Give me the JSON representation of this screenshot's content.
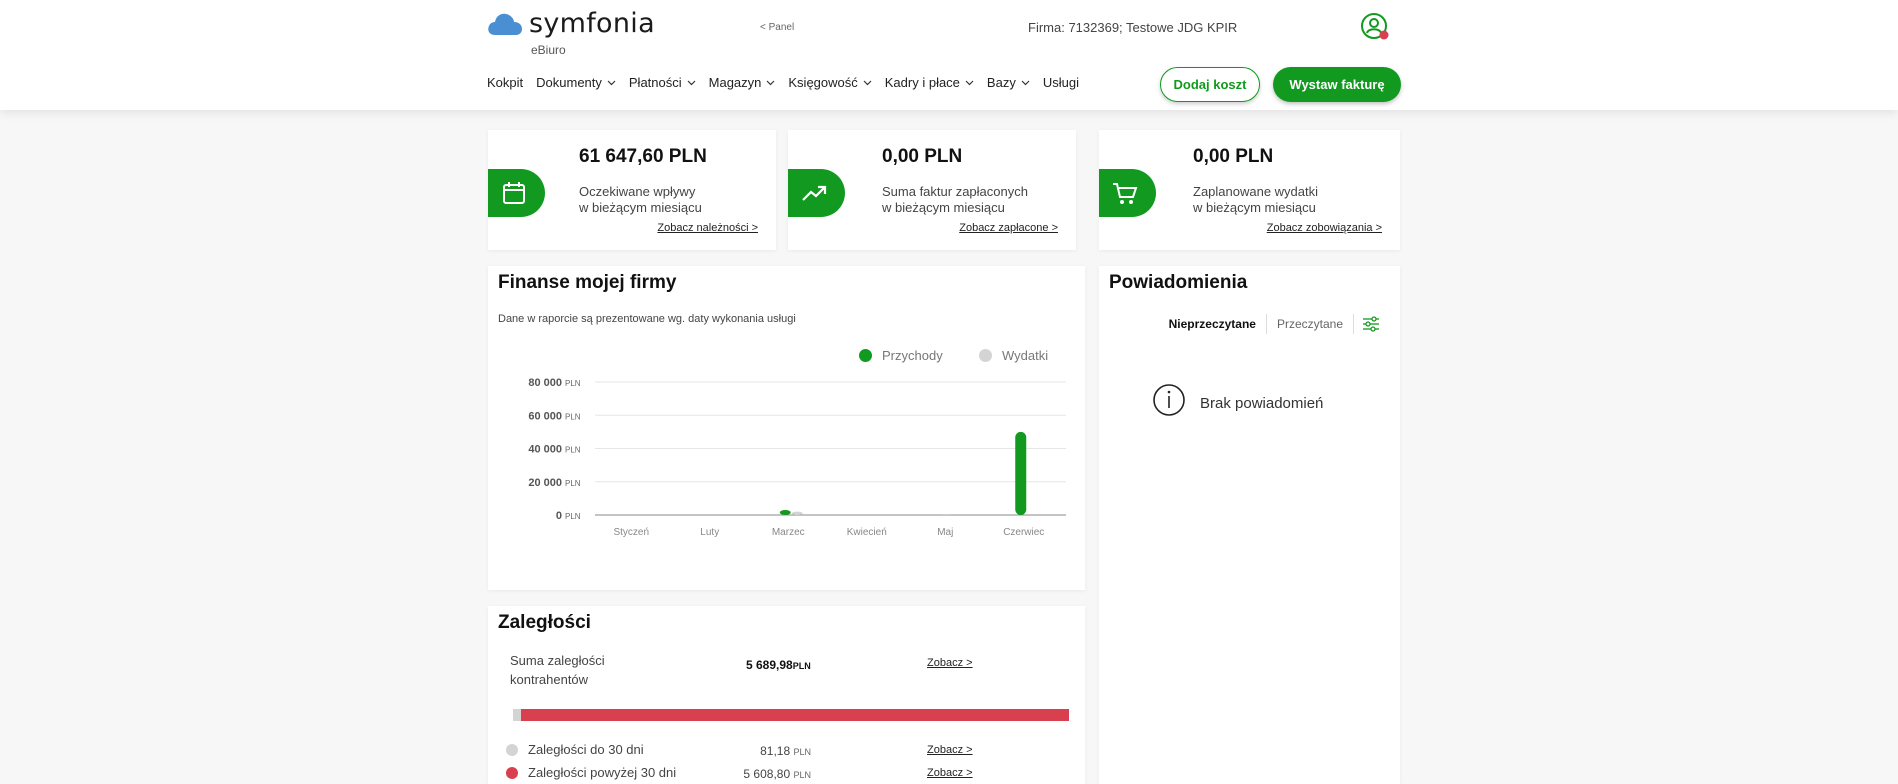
{
  "header": {
    "logo_text": "symfonia",
    "logo_sub": "eBiuro",
    "back_link": "< Panel",
    "company": "Firma:  7132369; Testowe JDG KPIR",
    "nav": [
      {
        "label": "Kokpit",
        "dropdown": false
      },
      {
        "label": "Dokumenty",
        "dropdown": true
      },
      {
        "label": "Płatności",
        "dropdown": true
      },
      {
        "label": "Magazyn",
        "dropdown": true
      },
      {
        "label": "Księgowość",
        "dropdown": true
      },
      {
        "label": "Kadry i płace",
        "dropdown": true
      },
      {
        "label": "Bazy",
        "dropdown": true
      },
      {
        "label": "Usługi",
        "dropdown": false
      }
    ],
    "btn_add_cost": "Dodaj koszt",
    "btn_invoice": "Wystaw fakturę"
  },
  "stats": [
    {
      "amount": "61 647,60 PLN",
      "line1": "Oczekiwane wpływy",
      "line2": "w bieżącym miesiącu",
      "link": "Zobacz należności >",
      "icon": "calendar-icon"
    },
    {
      "amount": "0,00 PLN",
      "line1": "Suma faktur zapłaconych",
      "line2": "w bieżącym miesiącu",
      "link": "Zobacz zapłacone >",
      "icon": "trend-up-icon"
    },
    {
      "amount": "0,00 PLN",
      "line1": "Zaplanowane wydatki",
      "line2": "w bieżącym miesiącu",
      "link": "Zobacz zobowiązania >",
      "icon": "cart-icon"
    }
  ],
  "finance": {
    "title": "Finanse mojej firmy",
    "subtitle": "Dane w raporcie są prezentowane wg. daty wykonania usługi"
  },
  "chart_data": {
    "type": "bar",
    "categories": [
      "Styczeń",
      "Luty",
      "Marzec",
      "Kwiecień",
      "Maj",
      "Czerwiec"
    ],
    "series": [
      {
        "name": "Przychody",
        "color": "#119a1f",
        "values": [
          0,
          0,
          3000,
          0,
          0,
          50000
        ]
      },
      {
        "name": "Wydatki",
        "color": "#d4d4d4",
        "values": [
          0,
          0,
          2000,
          0,
          0,
          0
        ]
      }
    ],
    "yticks": [
      {
        "value": 0,
        "label": "0"
      },
      {
        "value": 20000,
        "label": "20 000"
      },
      {
        "value": 40000,
        "label": "40 000"
      },
      {
        "value": 60000,
        "label": "60 000"
      },
      {
        "value": 80000,
        "label": "80 000"
      }
    ],
    "yunit": "PLN",
    "ylim": [
      0,
      80000
    ],
    "legend_position": "top-right",
    "grid": true
  },
  "notifications": {
    "title": "Powiadomienia",
    "tab_unread": "Nieprzeczytane",
    "tab_read": "Przeczytane",
    "empty": "Brak powiadomień"
  },
  "arrears": {
    "title": "Zaległości",
    "total_line1": "Suma zaległości",
    "total_line2": "kontrahentów",
    "total_value": "5 689,98",
    "unit": "PLN",
    "link": "Zobacz >",
    "share_under_30": 0.0143,
    "rows": [
      {
        "label": "Zaległości do 30 dni",
        "value": "81,18",
        "color": "#d4d4d4",
        "link": "Zobacz >"
      },
      {
        "label": "Zaległości powyżej 30 dni",
        "value": "5 608,80",
        "color": "#d84050",
        "link": "Zobacz >"
      }
    ]
  },
  "colors": {
    "accent": "#119a1f",
    "danger": "#d84050",
    "logo_blue": "#4a8fd1"
  }
}
